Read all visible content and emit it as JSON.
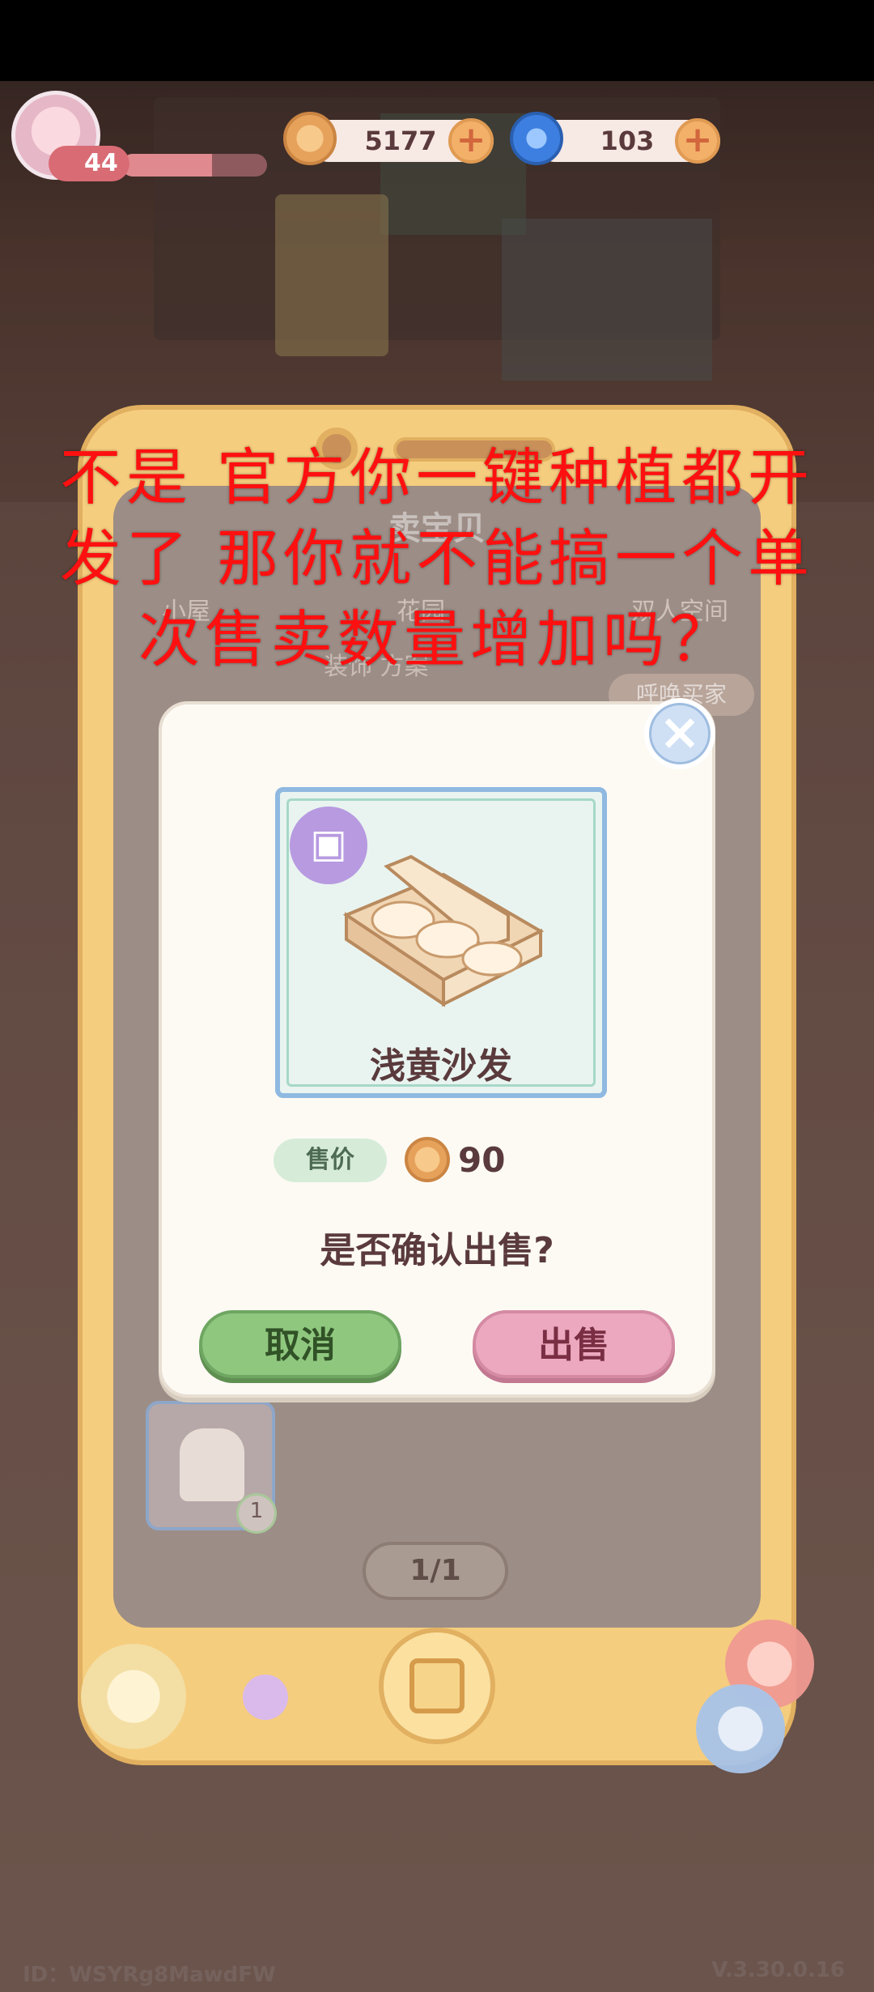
{
  "hud": {
    "level": "44",
    "xp_fraction": 0.62,
    "coins": "5177",
    "gems": "103",
    "coin_color": "#e6a15a",
    "gem_color": "#3d7fe0"
  },
  "background_panel": {
    "title": "卖宝贝",
    "tabs": [
      "小屋",
      "花园",
      "双人空间"
    ],
    "subtitle": "装饰 方案",
    "call_button": "呼唤买家",
    "pager": "1/1",
    "list_item_count": "1"
  },
  "dialog": {
    "item_name": "浅黄沙发",
    "price_label": "售价",
    "price": "90",
    "confirm_text": "是否确认出售?",
    "cancel_label": "取消",
    "sell_label": "出售",
    "accent_cancel": "#8fc77f",
    "accent_sell": "#eba8be"
  },
  "overlay": {
    "lines": [
      "不是 官方你一键种植都开",
      "发了 那你就不能搞一个单",
      "次售卖数量增加吗？"
    ]
  },
  "footer": {
    "id": "ID：WSYRg8MawdFW",
    "version": "V.3.30.0.16"
  }
}
